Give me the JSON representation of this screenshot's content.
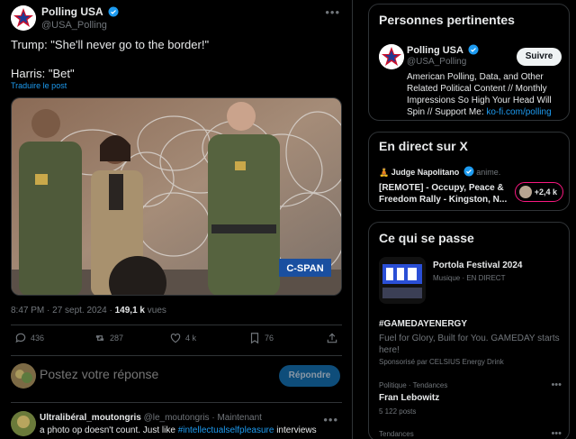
{
  "post": {
    "author": "Polling USA",
    "handle": "@USA_Polling",
    "text": "Trump: \"She'll never go to the border!\"\n\nHarris: \"Bet\"",
    "translate": "Traduire le post",
    "video_logo": "C-SPAN",
    "time": "8:47 PM · 27 sept. 2024 · ",
    "views_count": "149,1 k",
    "views_label": " vues",
    "replies": "436",
    "reposts": "287",
    "likes": "4 k",
    "bookmarks": "76"
  },
  "reply": {
    "placeholder": "Postez votre réponse",
    "button": "Répondre"
  },
  "comment": {
    "author": "Ultralibéral_moutongris",
    "handle": "@le_moutongris",
    "time": " · Maintenant",
    "text_before": "a photo op doesn't count. Just like ",
    "hashtag": "#intellectualselfpleasure",
    "text_after": " interviews"
  },
  "sidebar": {
    "relevant": {
      "title": "Personnes pertinentes",
      "name": "Polling USA",
      "handle": "@USA_Polling",
      "follow": "Suivre",
      "bio": "American Polling, Data, and Other Related Political Content // Monthly Impressions So High Your Head Will Spin // Support Me: ",
      "link": "ko-fi.com/polling"
    },
    "live": {
      "title": "En direct sur X",
      "host_emoji": "🧘",
      "host": "Judge Napolitano",
      "host_suffix": " anime.",
      "space_title": "[REMOTE] - Occupy, Peace & Freedom Rally - Kingston, N...",
      "listeners": "+2,4 k"
    },
    "trends": {
      "title": "Ce qui se passe",
      "t1_name": "Portola Festival 2024",
      "t1_sub": "Musique · EN DIRECT",
      "t2_name": "#GAMEDAYENERGY",
      "t2_desc": "Fuel for Glory, Built for You. GAMEDAY starts here!",
      "t2_spons": "Sponsorisé par CELSIUS Energy Drink",
      "t3_cat": "Politique · Tendances",
      "t3_name": "Fran Lebowitz",
      "t3_count": "5 122 posts",
      "t4_cat": "Tendances"
    }
  },
  "colors": {
    "accent": "#1d9bf0",
    "live_pink": "#f91880",
    "background": "#000000",
    "border": "#2f3336"
  },
  "icons": [
    "verified-badge-icon",
    "more-icon",
    "reply-icon",
    "repost-icon",
    "like-icon",
    "bookmark-icon",
    "share-icon"
  ]
}
